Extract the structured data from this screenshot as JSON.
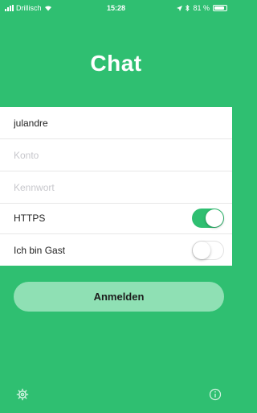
{
  "status_bar": {
    "carrier": "Drillisch",
    "time": "15:28",
    "battery": "81 %"
  },
  "app": {
    "title": "Chat"
  },
  "form": {
    "username_value": "julandre",
    "account_placeholder": "Konto",
    "password_placeholder": "Kennwort",
    "https_label": "HTTPS",
    "https_enabled": true,
    "guest_label": "Ich bin Gast",
    "guest_enabled": false
  },
  "actions": {
    "login_label": "Anmelden"
  },
  "footer": {
    "settings_icon": "gear-icon",
    "info_icon": "info-icon"
  },
  "colors": {
    "brand_green": "#2fbf71",
    "button_green": "#8fe0b4"
  }
}
